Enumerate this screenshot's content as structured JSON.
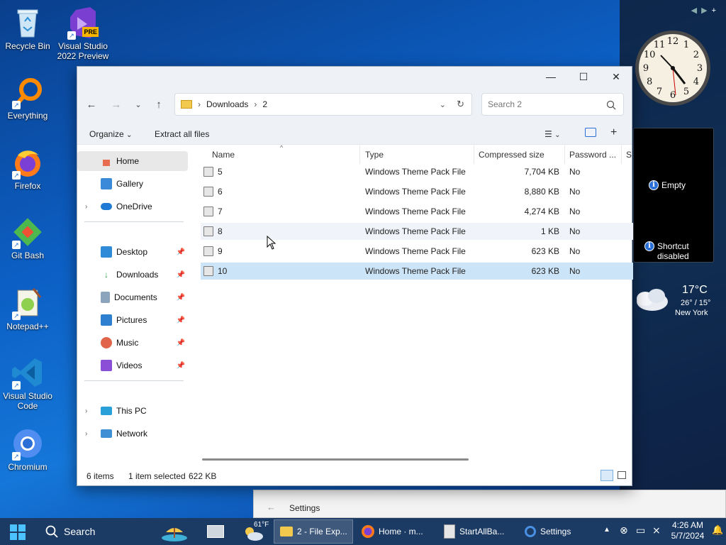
{
  "desktop": {
    "icons": [
      {
        "label": "Recycle Bin"
      },
      {
        "label": "Visual Studio 2022 Preview",
        "badge": "PRE"
      },
      {
        "label": "Everything"
      },
      {
        "label": "Firefox"
      },
      {
        "label": "Git Bash"
      },
      {
        "label": "Notepad++"
      },
      {
        "label": "Visual Studio Code"
      },
      {
        "label": "Chromium"
      }
    ]
  },
  "gadgets": {
    "nav_prev": "◀",
    "nav_next": "▶",
    "nav_add": "+",
    "clock_numbers": [
      "12",
      "1",
      "2",
      "3",
      "4",
      "5",
      "6",
      "7",
      "8",
      "9",
      "10",
      "11"
    ],
    "info_empty": "Empty",
    "info_shortcut": "Shortcut disabled",
    "weather_temp": "17°C",
    "weather_range": "26° / 15°",
    "weather_city": "New York"
  },
  "explorer": {
    "window_title_buttons": {
      "minimize": "—",
      "maximize": "☐",
      "close": "✕"
    },
    "breadcrumb": [
      "Downloads",
      "2"
    ],
    "search_placeholder": "Search 2",
    "commands": {
      "organize": "Organize",
      "extract_all": "Extract all files"
    },
    "nav": {
      "home": "Home",
      "gallery": "Gallery",
      "onedrive": "OneDrive",
      "desktop": "Desktop",
      "downloads": "Downloads",
      "documents": "Documents",
      "pictures": "Pictures",
      "music": "Music",
      "videos": "Videos",
      "thispc": "This PC",
      "network": "Network"
    },
    "columns": {
      "name": "Name",
      "type": "Type",
      "compressed": "Compressed size",
      "password": "Password ...",
      "size": "Si"
    },
    "rows": [
      {
        "name": "5",
        "type": "Windows Theme Pack File",
        "size": "7,704 KB",
        "password": "No"
      },
      {
        "name": "6",
        "type": "Windows Theme Pack File",
        "size": "8,880 KB",
        "password": "No"
      },
      {
        "name": "7",
        "type": "Windows Theme Pack File",
        "size": "4,274 KB",
        "password": "No"
      },
      {
        "name": "8",
        "type": "Windows Theme Pack File",
        "size": "1 KB",
        "password": "No"
      },
      {
        "name": "9",
        "type": "Windows Theme Pack File",
        "size": "623 KB",
        "password": "No"
      },
      {
        "name": "10",
        "type": "Windows Theme Pack File",
        "size": "623 KB",
        "password": "No"
      }
    ],
    "status": {
      "items": "6 items",
      "selected": "1 item selected",
      "selected_size": "622 KB"
    }
  },
  "settings_window": {
    "title": "Settings"
  },
  "taskbar": {
    "search_label": "Search",
    "weather_badge": "61°F",
    "items": [
      {
        "label": "2 - File Exp..."
      },
      {
        "label": "Home · m..."
      },
      {
        "label": "StartAllBa..."
      },
      {
        "label": "Settings"
      }
    ],
    "time": "4:26 AM",
    "date": "5/7/2024"
  },
  "colors": {
    "accent": "#0a64d8",
    "selection": "#cce4f7",
    "taskbar": "#1b3a64"
  }
}
